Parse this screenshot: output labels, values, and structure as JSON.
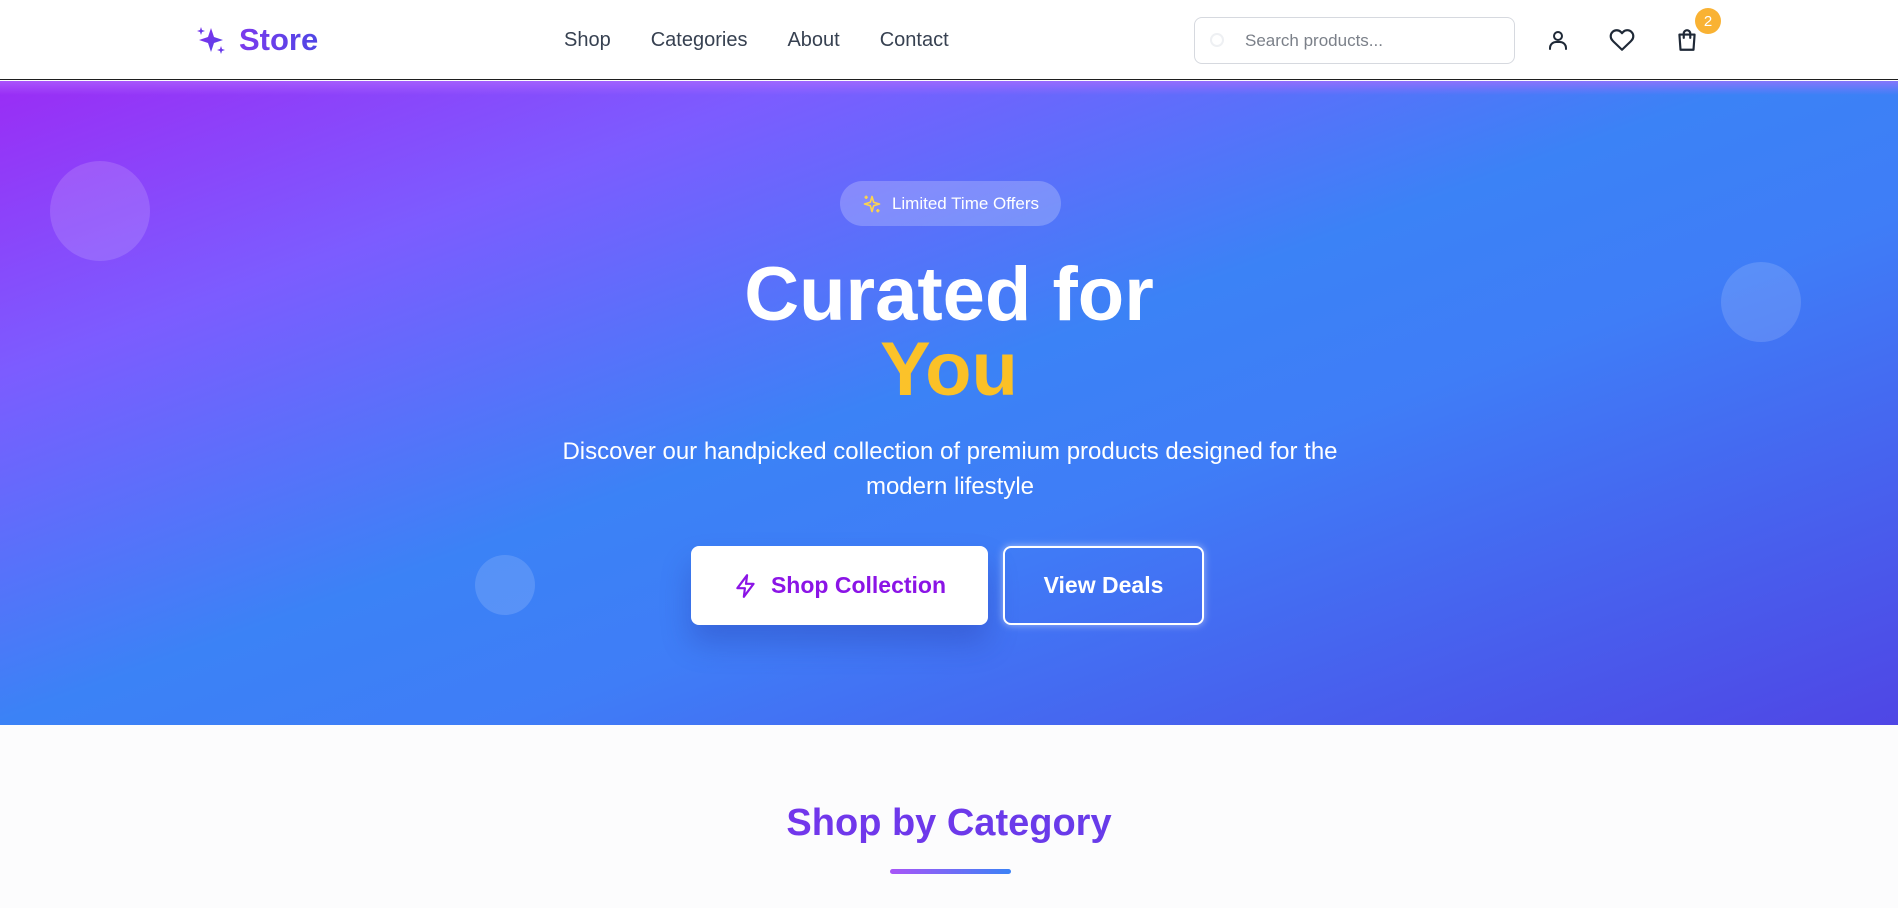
{
  "brand": {
    "name": "Store"
  },
  "nav": {
    "links": [
      "Shop",
      "Categories",
      "About",
      "Contact"
    ],
    "search_placeholder": "Search products...",
    "cart_count": "2"
  },
  "hero": {
    "pill_text": "Limited Time Offers",
    "title_line1": "Curated for",
    "title_line2": "You",
    "subtitle": "Discover our handpicked collection of premium products designed for the modern lifestyle",
    "primary_cta": "Shop Collection",
    "secondary_cta": "View Deals"
  },
  "section": {
    "title": "Shop by Category"
  },
  "colors": {
    "brand_primary": "#4f46e5",
    "brand_purple": "#8b14e6",
    "accent_gold": "#fbbf24",
    "badge": "#f9b233"
  },
  "icons": [
    "sparkles-icon",
    "search-icon",
    "user-icon",
    "heart-icon",
    "shopping-bag-icon",
    "lightning-icon"
  ]
}
